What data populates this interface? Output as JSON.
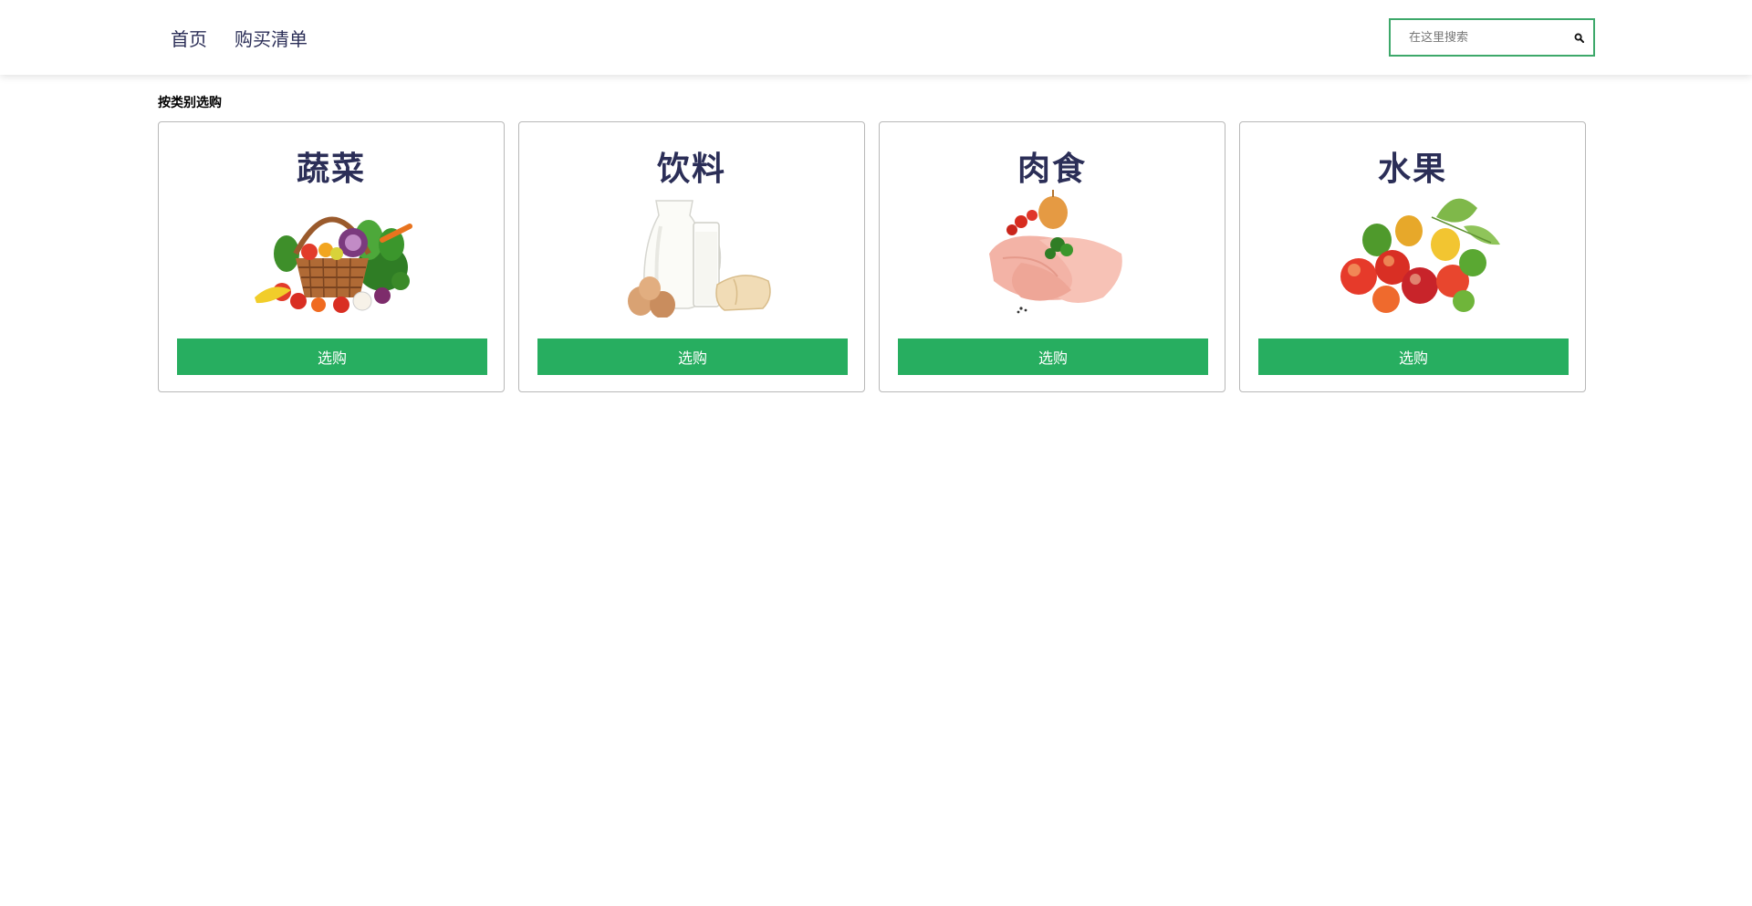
{
  "nav": {
    "links": [
      {
        "label": "首页"
      },
      {
        "label": "购买清单"
      }
    ]
  },
  "search": {
    "placeholder": "在这里搜索",
    "value": "",
    "icon": "search-icon",
    "border_color": "#3da86a"
  },
  "section": {
    "title": "按类别选购"
  },
  "categories": [
    {
      "title": "蔬菜",
      "button": "选购",
      "image": "vegetable-basket-image"
    },
    {
      "title": "饮料",
      "button": "选购",
      "image": "milk-eggs-bread-image"
    },
    {
      "title": "肉食",
      "button": "选购",
      "image": "raw-chicken-image"
    },
    {
      "title": "水果",
      "button": "选购",
      "image": "fruits-image"
    }
  ],
  "colors": {
    "accent": "#27ae60",
    "title_text": "#2b2e57",
    "card_border": "#b8b8b8"
  }
}
